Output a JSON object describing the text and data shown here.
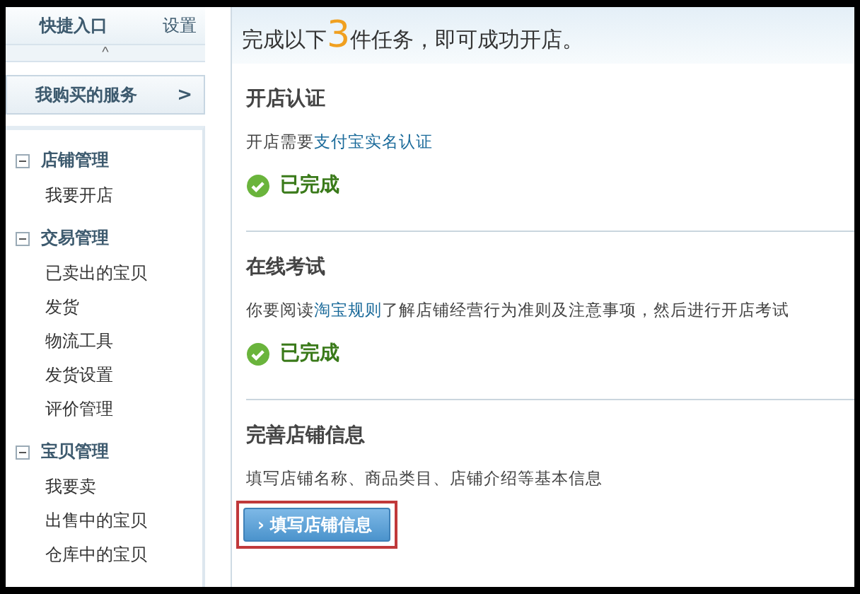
{
  "sidebar": {
    "quick_title": "快捷入口",
    "settings_link": "设置",
    "collapse_arrow": "^",
    "service_link": {
      "label": "我购买的服务",
      "arrow": ">"
    },
    "groups": [
      {
        "title": "店铺管理",
        "expanded": true,
        "items": [
          "我要开店"
        ]
      },
      {
        "title": "交易管理",
        "expanded": true,
        "items": [
          "已卖出的宝贝",
          "发货",
          "物流工具",
          "发货设置",
          "评价管理"
        ]
      },
      {
        "title": "宝贝管理",
        "expanded": true,
        "items": [
          "我要卖",
          "出售中的宝贝",
          "仓库中的宝贝"
        ]
      }
    ]
  },
  "headline": {
    "before": "完成以下",
    "count": "3",
    "after": "件任务，即可成功开店。"
  },
  "tasks": [
    {
      "title": "开店认证",
      "text_before": "开店需要",
      "link": "支付宝实名认证",
      "done": true,
      "status": "已完成"
    },
    {
      "title": "在线考试",
      "text_before": "你要阅读",
      "link": "淘宝规则",
      "text_after": "了解店铺经营行为准则及注意事项，然后进行开店考试",
      "done": true,
      "status": "已完成"
    },
    {
      "title": "完善店铺信息",
      "text_before": "填写店铺名称、商品类目、店铺介绍等基本信息",
      "done": false,
      "button": {
        "arrow": "›",
        "label": "填写店铺信息",
        "highlighted": true
      }
    }
  ]
}
